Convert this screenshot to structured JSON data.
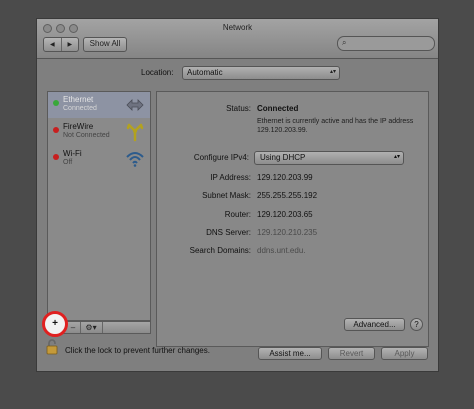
{
  "window": {
    "title": "Network"
  },
  "toolbar": {
    "back": "◀",
    "forward": "▶",
    "show_all": "Show All",
    "search_placeholder": ""
  },
  "location": {
    "label": "Location:",
    "value": "Automatic"
  },
  "services": [
    {
      "name": "Ethernet",
      "status": "Connected",
      "status_color": "#39a83a",
      "selected": true,
      "icon": "ethernet-icon"
    },
    {
      "name": "FireWire",
      "status": "Not Connected",
      "status_color": "#c81f1f",
      "selected": false,
      "icon": "firewire-icon"
    },
    {
      "name": "Wi-Fi",
      "status": "Off",
      "status_color": "#c81f1f",
      "selected": false,
      "icon": "wifi-icon"
    }
  ],
  "list_controls": {
    "add": "+",
    "remove": "–",
    "gear": "⚙▾"
  },
  "detail": {
    "status_label": "Status:",
    "status_value": "Connected",
    "status_description": "Ethernet is currently active and has the IP address 129.120.203.99.",
    "configure_label": "Configure IPv4:",
    "configure_value": "Using DHCP",
    "ip_label": "IP Address:",
    "ip_value": "129.120.203.99",
    "subnet_label": "Subnet Mask:",
    "subnet_value": "255.255.255.192",
    "router_label": "Router:",
    "router_value": "129.120.203.65",
    "dns_label": "DNS Server:",
    "dns_value": "129.120.210.235",
    "search_domains_label": "Search Domains:",
    "search_domains_value": "ddns.unt.edu.",
    "advanced": "Advanced...",
    "help": "?"
  },
  "footer": {
    "lock_text": "Click the lock to prevent further changes.",
    "assist": "Assist me...",
    "revert": "Revert",
    "apply": "Apply"
  }
}
